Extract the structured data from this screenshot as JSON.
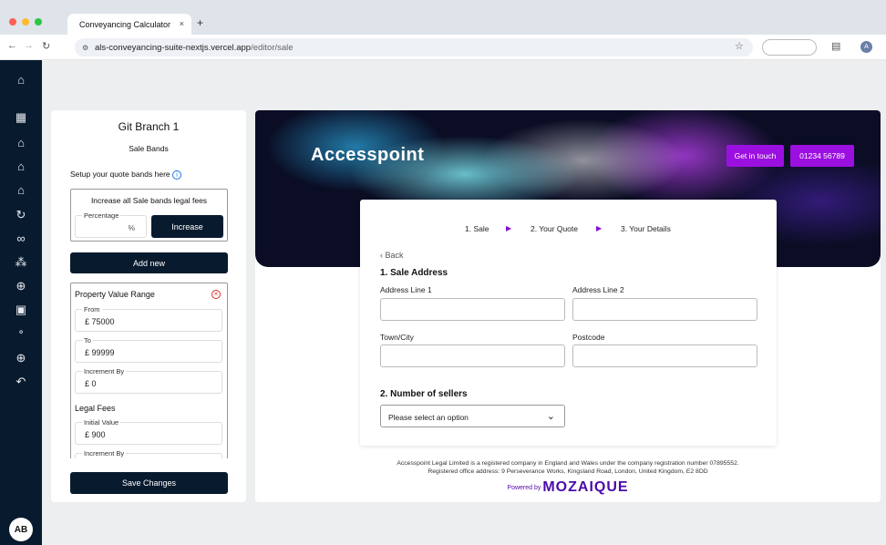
{
  "browser": {
    "tab_title": "Conveyancing Calculator",
    "tab_close": "×",
    "new_tab": "+",
    "url_host": "als-conveyancing-suite-nextjs.vercel.app",
    "url_path": "/editor/sale"
  },
  "sidebar": {
    "avatar": "AB"
  },
  "panel": {
    "title": "Git Branch 1",
    "subtitle": "Sale Bands",
    "setup_text": "Setup your quote bands here",
    "increase_box": {
      "title": "Increase all Sale bands legal fees",
      "percentage_label": "Percentage",
      "percentage_unit": "%",
      "increase_button": "Increase"
    },
    "add_new": "Add new",
    "range": {
      "title": "Property Value Range",
      "from_label": "From",
      "from_value": "£ 75000",
      "to_label": "To",
      "to_value": "£ 99999",
      "increment_label": "Increment By",
      "increment_value": "£ 0"
    },
    "legal": {
      "title": "Legal Fees",
      "initial_label": "Initial Value",
      "initial_value": "£ 900",
      "increment_label": "Increment By"
    },
    "save": "Save Changes"
  },
  "preview": {
    "brand": "Accesspoint",
    "get_in_touch": "Get in touch",
    "phone": "01234 56789",
    "steps": [
      "1. Sale",
      "2. Your Quote",
      "3. Your Details"
    ],
    "back": "Back",
    "section1": "1. Sale Address",
    "address1": "Address Line 1",
    "address2": "Address Line 2",
    "town": "Town/City",
    "postcode": "Postcode",
    "section2": "2. Number of sellers",
    "select_placeholder": "Please select an option",
    "footer_line1": "Accesspoint Legal Limited is a registered company in England and Wales under the company registration number 07895552.",
    "footer_line2": "Registered office address: 9 Perseverance Works, Kingsland Road, London, United Kingdom, E2 8DD",
    "powered_by": "Powered by",
    "powered_brand": "MOZAIQUE"
  },
  "colors": {
    "nav": "#081a2e",
    "accent": "#9b10e0"
  }
}
